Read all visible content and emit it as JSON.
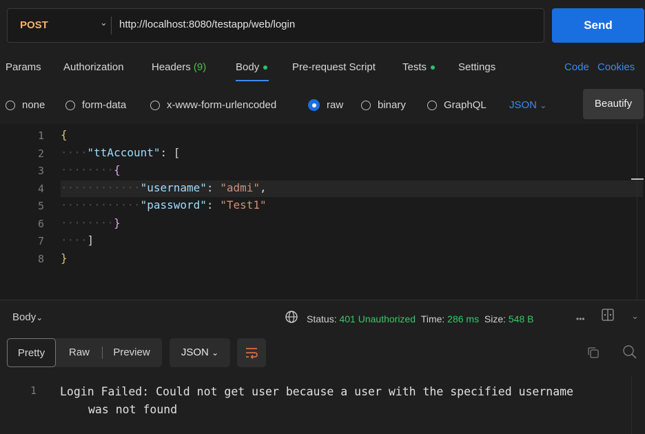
{
  "request": {
    "method": "POST",
    "url": "http://localhost:8080/testapp/web/login",
    "send_label": "Send"
  },
  "tabs": {
    "params": "Params",
    "authorization": "Authorization",
    "headers": "Headers",
    "headers_count": "(9)",
    "body": "Body",
    "prerequest": "Pre-request Script",
    "tests": "Tests",
    "settings": "Settings",
    "code": "Code",
    "cookies": "Cookies"
  },
  "body_types": {
    "none": "none",
    "form_data": "form-data",
    "urlencoded": "x-www-form-urlencoded",
    "raw": "raw",
    "binary": "binary",
    "graphql": "GraphQL",
    "selected": "raw",
    "language": "JSON",
    "beautify": "Beautify"
  },
  "editor": {
    "line_numbers": [
      "1",
      "2",
      "3",
      "4",
      "5",
      "6",
      "7",
      "8"
    ],
    "lines": {
      "l1": "{",
      "l2_key": "\"ttAccount\"",
      "l2_rest": ": [",
      "l3": "{",
      "l4_key": "\"username\"",
      "l4_val": "\"admi\"",
      "l5_key": "\"password\"",
      "l5_val": "\"Test1\"",
      "l6": "}",
      "l7": "]",
      "l8": "}"
    }
  },
  "response": {
    "section_label": "Body",
    "status_label": "Status:",
    "status_value": "401 Unauthorized",
    "time_label": "Time:",
    "time_value": "286 ms",
    "size_label": "Size:",
    "size_value": "548 B",
    "views": {
      "pretty": "Pretty",
      "raw": "Raw",
      "preview": "Preview"
    },
    "format": "JSON",
    "line_number": "1",
    "text_line1": "Login Failed: Could not get user because a user with the specified username",
    "text_line2": "was not found"
  },
  "colors": {
    "method": "#f2b56b",
    "send": "#1a6fe0",
    "accent": "#3a8bf0",
    "status_ok_text": "#3bc66a"
  }
}
